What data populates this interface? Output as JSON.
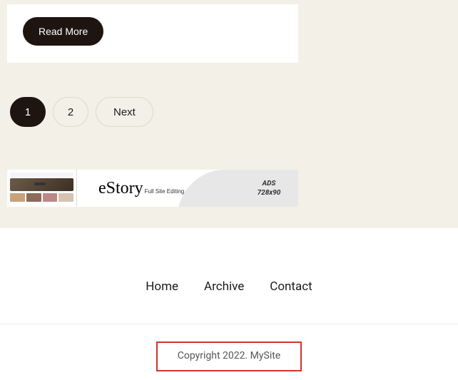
{
  "card": {
    "read_more_label": "Read More"
  },
  "pagination": {
    "page1": "1",
    "page2": "2",
    "next": "Next"
  },
  "ad": {
    "brand": "eStory",
    "tagline": "Full Site Editing",
    "label_line1": "ADS",
    "label_line2": "728x90"
  },
  "footer": {
    "nav": {
      "home": "Home",
      "archive": "Archive",
      "contact": "Contact"
    },
    "copyright": "Copyright 2022. MySite"
  }
}
